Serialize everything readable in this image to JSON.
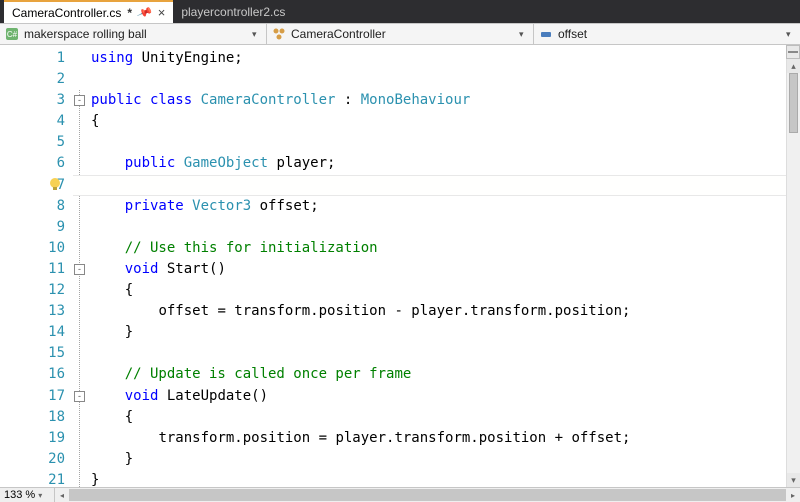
{
  "tabs": [
    {
      "label": "CameraController.cs",
      "active": true,
      "dirty": true
    },
    {
      "label": "playercontroller2.cs",
      "active": false,
      "dirty": false
    }
  ],
  "nav": {
    "project": "makerspace rolling ball",
    "class": "CameraController",
    "member": "offset"
  },
  "zoom": "133 %",
  "colors": {
    "keyword": "#0000ff",
    "type": "#2b91af",
    "comment": "#008000"
  },
  "cursor_line": 7,
  "lines": [
    {
      "n": 1,
      "ind": 0,
      "seg": [
        [
          "kw",
          "using"
        ],
        [
          "ident",
          " UnityEngine;"
        ]
      ]
    },
    {
      "n": 2,
      "ind": 0,
      "seg": []
    },
    {
      "n": 3,
      "ind": 0,
      "fold": true,
      "seg": [
        [
          "kw",
          "public class"
        ],
        [
          "ident",
          " "
        ],
        [
          "type",
          "CameraController"
        ],
        [
          "ident",
          " : "
        ],
        [
          "type",
          "MonoBehaviour"
        ]
      ]
    },
    {
      "n": 4,
      "ind": 0,
      "seg": [
        [
          "ident",
          "{"
        ]
      ]
    },
    {
      "n": 5,
      "ind": 0,
      "seg": []
    },
    {
      "n": 6,
      "ind": 1,
      "seg": [
        [
          "kw",
          "public"
        ],
        [
          "ident",
          " "
        ],
        [
          "type",
          "GameObject"
        ],
        [
          "ident",
          " player;"
        ]
      ]
    },
    {
      "n": 7,
      "ind": 1,
      "seg": []
    },
    {
      "n": 8,
      "ind": 1,
      "seg": [
        [
          "kw",
          "private"
        ],
        [
          "ident",
          " "
        ],
        [
          "type",
          "Vector3"
        ],
        [
          "ident",
          " offset;"
        ]
      ]
    },
    {
      "n": 9,
      "ind": 0,
      "seg": []
    },
    {
      "n": 10,
      "ind": 1,
      "seg": [
        [
          "cmt",
          "// Use this for initialization"
        ]
      ]
    },
    {
      "n": 11,
      "ind": 1,
      "fold": true,
      "seg": [
        [
          "kw",
          "void"
        ],
        [
          "ident",
          " Start()"
        ]
      ]
    },
    {
      "n": 12,
      "ind": 1,
      "seg": [
        [
          "ident",
          "{"
        ]
      ]
    },
    {
      "n": 13,
      "ind": 2,
      "seg": [
        [
          "ident",
          "offset = transform.position - player.transform.position;"
        ]
      ]
    },
    {
      "n": 14,
      "ind": 1,
      "seg": [
        [
          "ident",
          "}"
        ]
      ]
    },
    {
      "n": 15,
      "ind": 0,
      "seg": []
    },
    {
      "n": 16,
      "ind": 1,
      "seg": [
        [
          "cmt",
          "// Update is called once per frame"
        ]
      ]
    },
    {
      "n": 17,
      "ind": 1,
      "fold": true,
      "seg": [
        [
          "kw",
          "void"
        ],
        [
          "ident",
          " LateUpdate()"
        ]
      ]
    },
    {
      "n": 18,
      "ind": 1,
      "seg": [
        [
          "ident",
          "{"
        ]
      ]
    },
    {
      "n": 19,
      "ind": 2,
      "seg": [
        [
          "ident",
          "transform.position = player.transform.position + offset;"
        ]
      ]
    },
    {
      "n": 20,
      "ind": 1,
      "seg": [
        [
          "ident",
          "}"
        ]
      ]
    },
    {
      "n": 21,
      "ind": 0,
      "seg": [
        [
          "ident",
          "}"
        ]
      ]
    }
  ]
}
